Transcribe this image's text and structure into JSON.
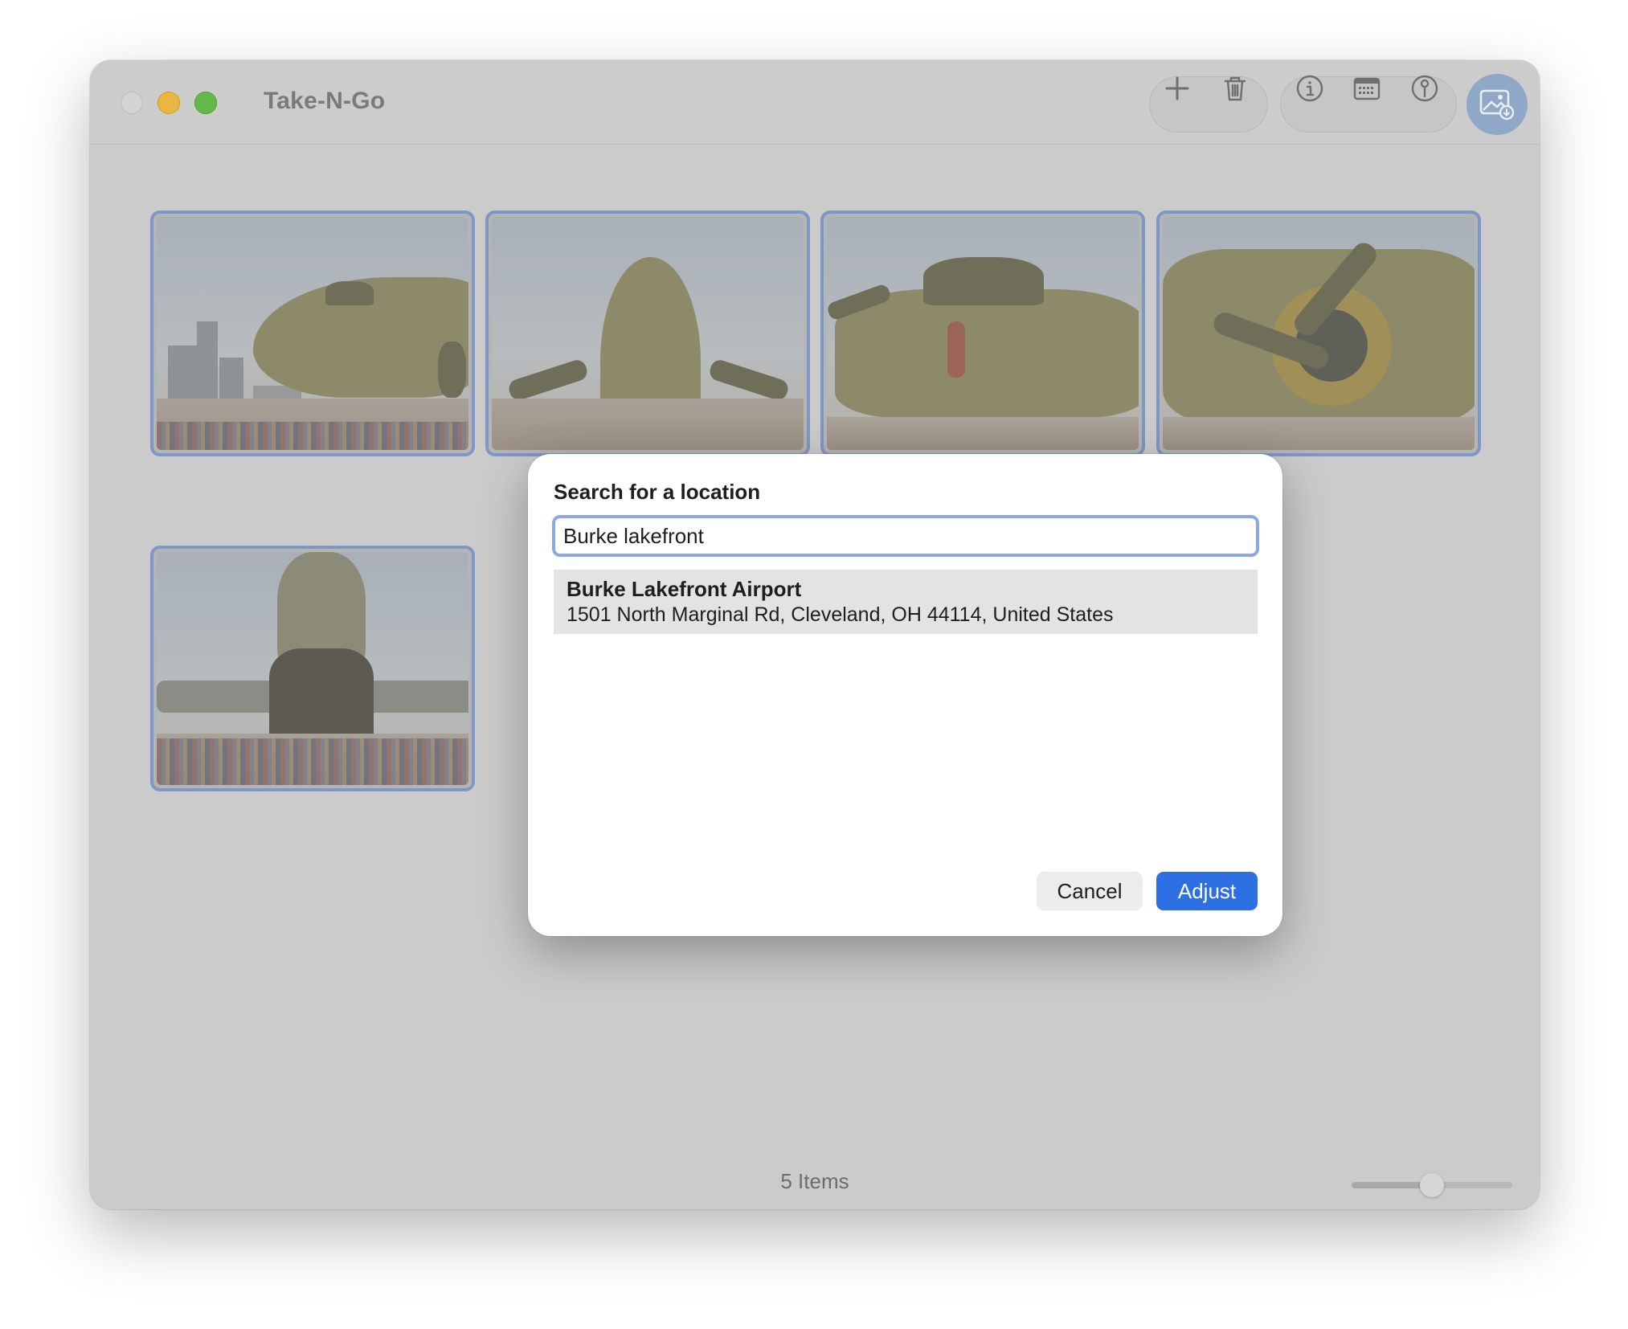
{
  "window": {
    "title": "Take-N-Go"
  },
  "toolbar": {
    "buttons": [
      {
        "name": "add",
        "icon": "plus-icon"
      },
      {
        "name": "delete",
        "icon": "trash-icon"
      },
      {
        "name": "info",
        "icon": "info-circle-icon"
      },
      {
        "name": "date",
        "icon": "calendar-icon"
      },
      {
        "name": "location",
        "icon": "pin-icon"
      },
      {
        "name": "photo",
        "icon": "photo-import-icon"
      }
    ]
  },
  "grid": {
    "thumbnails": [
      {
        "icon": "aircraft-photo"
      },
      {
        "icon": "aircraft-photo"
      },
      {
        "icon": "aircraft-photo"
      },
      {
        "icon": "aircraft-photo"
      },
      {
        "icon": "aircraft-photo"
      }
    ]
  },
  "footer": {
    "item_count": "5 Items",
    "zoom_slider_fraction": 0.5
  },
  "dialog": {
    "title": "Search for a location",
    "search_value": "Burke lakefront",
    "results": [
      {
        "name": "Burke Lakefront Airport",
        "address": "1501 North Marginal Rd, Cleveland, OH 44114, United States"
      }
    ],
    "cancel_label": "Cancel",
    "adjust_label": "Adjust",
    "accent_color": "#2f6fe4"
  }
}
